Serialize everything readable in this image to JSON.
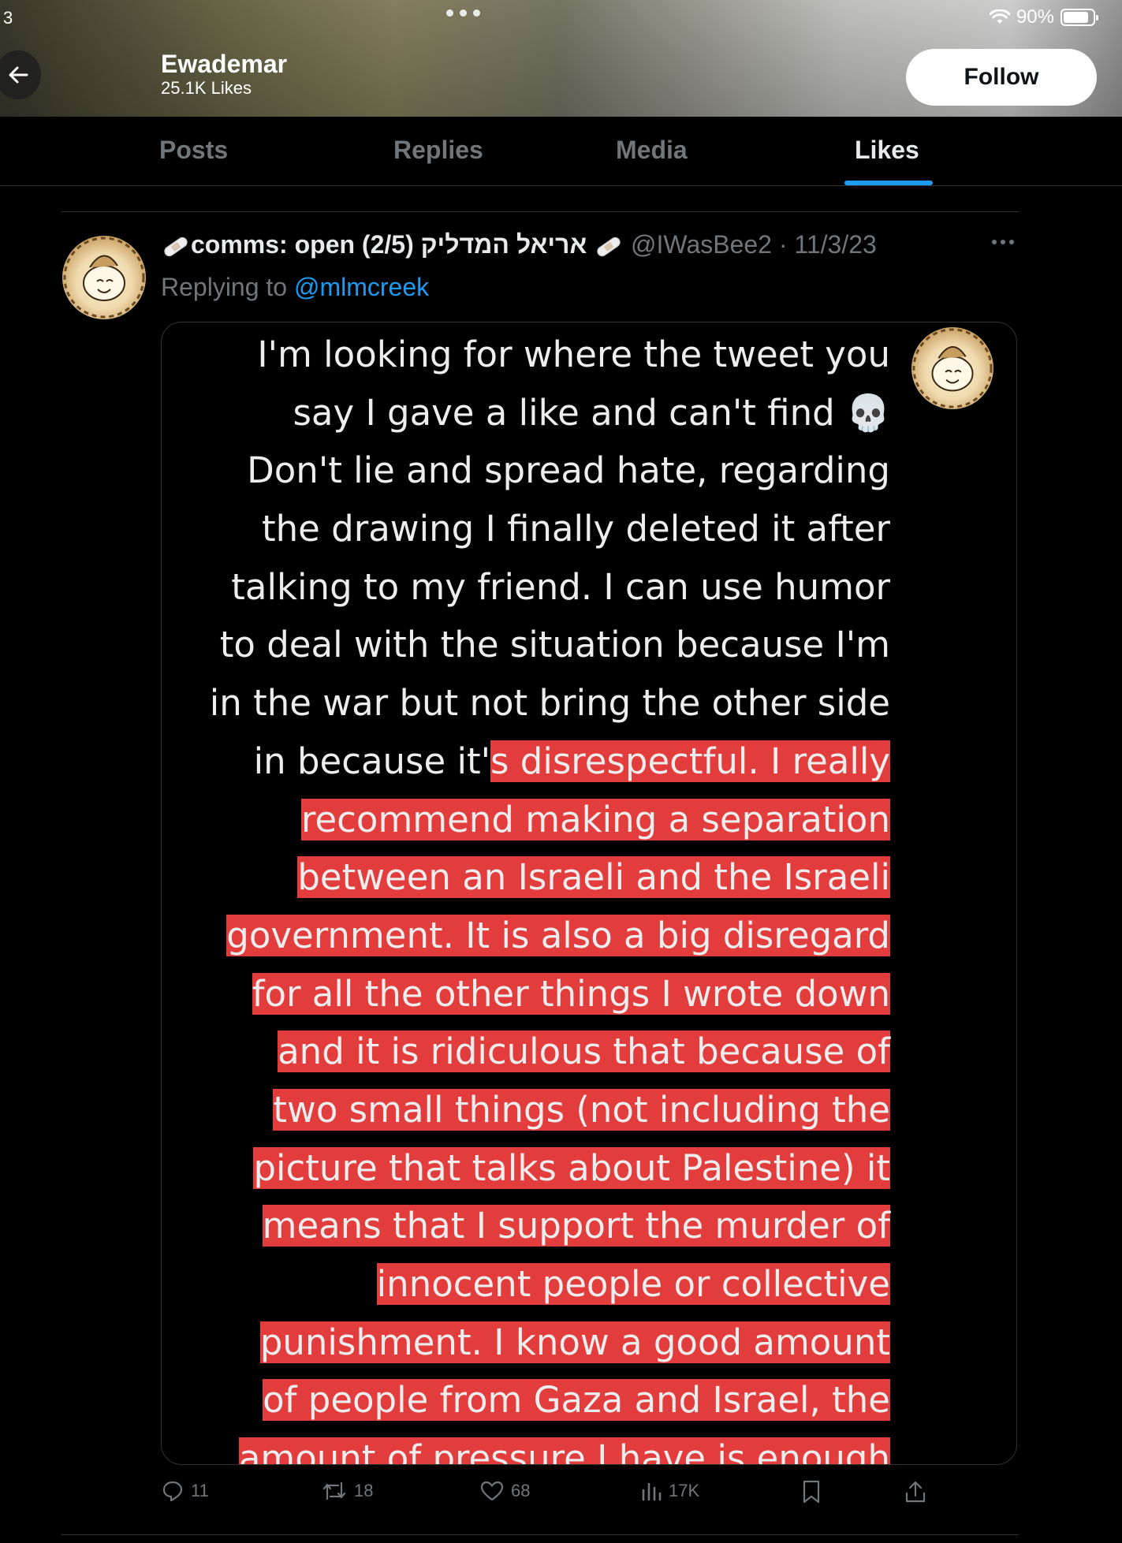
{
  "status_bar": {
    "time_fragment": "3",
    "battery": "90%",
    "battery_level": 0.9
  },
  "header": {
    "name": "Ewademar",
    "likes_count": "25.1K Likes",
    "follow_label": "Follow"
  },
  "tabs": [
    {
      "label": "Posts",
      "active": false
    },
    {
      "label": "Replies",
      "active": false
    },
    {
      "label": "Media",
      "active": false
    },
    {
      "label": "Likes",
      "active": true
    }
  ],
  "tweet": {
    "display_name": "comms: open (2/5) אריאל המדליק",
    "handle_date": "@IWasBee2 · 11/3/23",
    "replying_prefix": "Replying to",
    "replying_mention": "@mlmcreek",
    "image_lines": [
      {
        "text": "I'm looking for where the tweet you",
        "hl": ""
      },
      {
        "text": "say I gave a like and can't find 💀",
        "hl": ""
      },
      {
        "text": "Don't lie and spread hate, regarding",
        "hl": ""
      },
      {
        "text": "the drawing I finally deleted it after",
        "hl": ""
      },
      {
        "text": "talking to my friend.  I can use humor",
        "hl": ""
      },
      {
        "text": "to deal with the situation because I'm",
        "hl": ""
      },
      {
        "text": "in the war but not bring the other side",
        "hl": ""
      },
      {
        "text": "in because it'",
        "hl": "s disrespectful.  I really"
      },
      {
        "text": "",
        "hl": "recommend making a separation"
      },
      {
        "text": "",
        "hl": "between an Israeli and the Israeli"
      },
      {
        "text": "",
        "hl": "government.  It is also a big disregard"
      },
      {
        "text": "",
        "hl": "for all the other things I wrote down"
      },
      {
        "text": "",
        "hl": "and it is ridiculous that because of"
      },
      {
        "text": "",
        "hl": "two small things (not including the"
      },
      {
        "text": "",
        "hl": "picture that talks about Palestine) it"
      },
      {
        "text": "",
        "hl": "means that I support the murder of"
      },
      {
        "text": "",
        "hl": "innocent people or collective"
      },
      {
        "text": "",
        "hl": "punishment.  I know a good amount"
      },
      {
        "text": "",
        "hl": "of people from Gaza and Israel, the"
      },
      {
        "text": "",
        "hl": "amount of pressure I have is enough"
      }
    ],
    "highlight_color": "#e23c3c",
    "actions": {
      "replies": "11",
      "reposts": "18",
      "likes": "68",
      "views": "17K"
    }
  },
  "colors": {
    "accent": "#1d9bf0",
    "muted": "#71767b",
    "text": "#e7e9ea",
    "background": "#000000"
  },
  "icons": [
    "back-arrow-icon",
    "wifi-icon",
    "battery-icon",
    "bandage-icon",
    "more-icon",
    "reply-icon",
    "repost-icon",
    "like-icon",
    "views-icon",
    "bookmark-icon",
    "share-icon"
  ]
}
